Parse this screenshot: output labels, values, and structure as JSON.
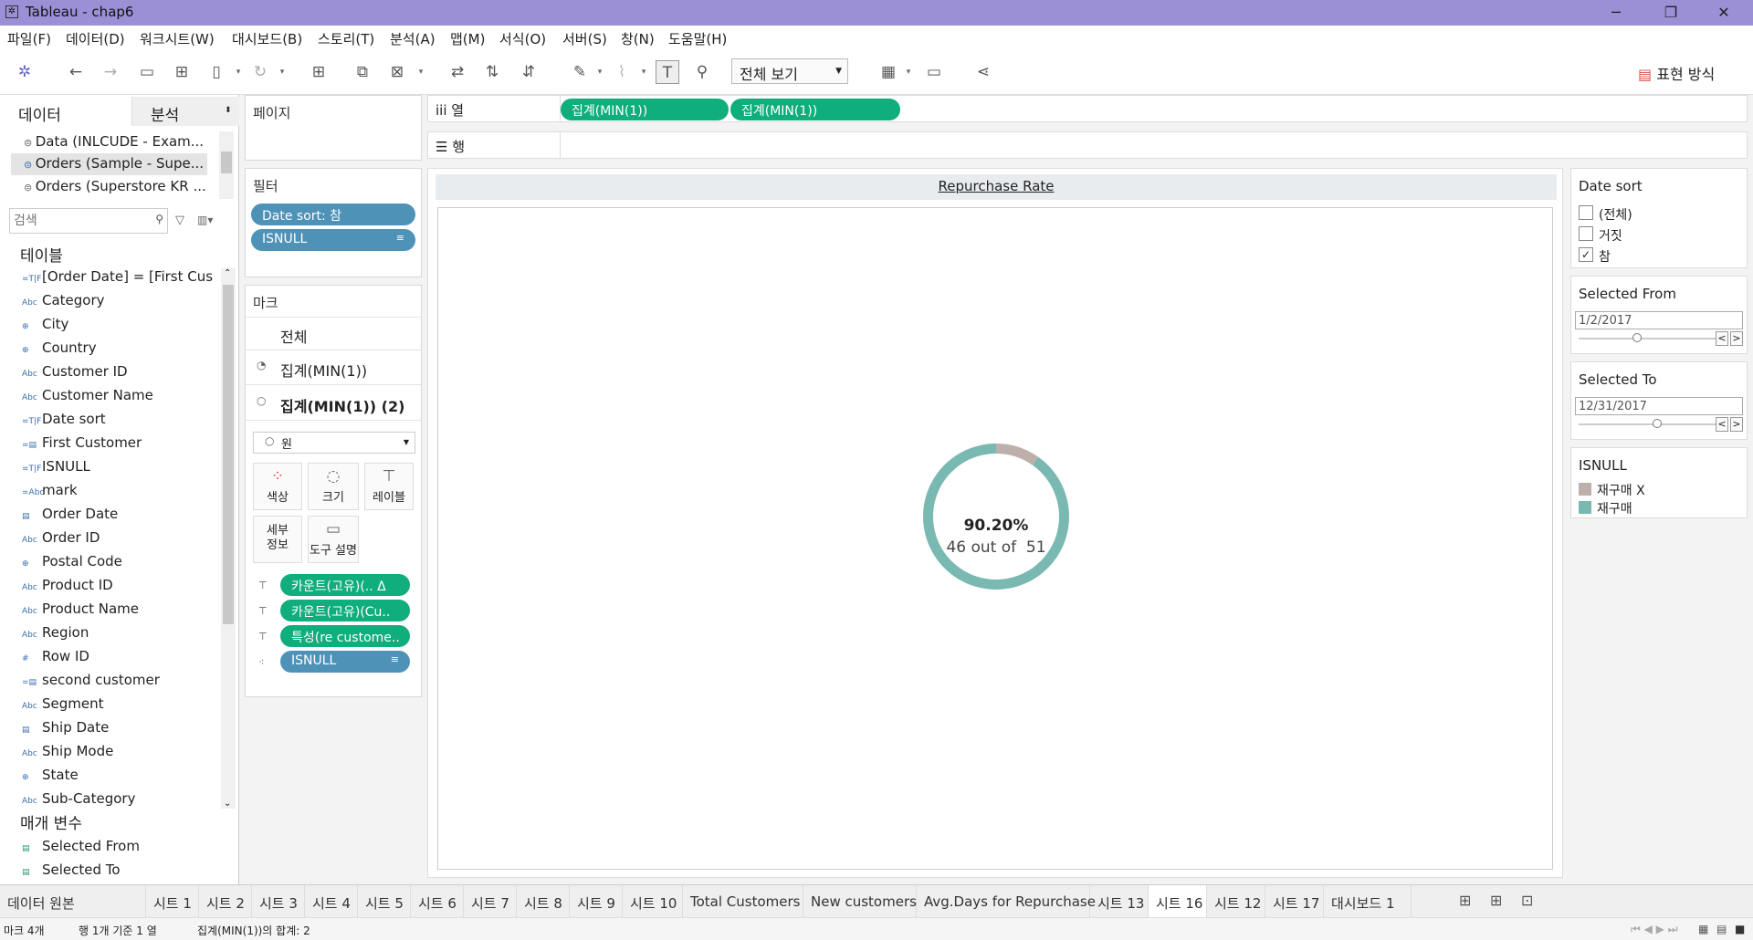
{
  "window": {
    "title": "Tableau - chap6"
  },
  "menu": [
    "파일(F)",
    "데이터(D)",
    "워크시트(W)",
    "대시보드(B)",
    "스토리(T)",
    "분석(A)",
    "맵(M)",
    "서식(O)",
    "서버(S)",
    "창(N)",
    "도움말(H)"
  ],
  "toolbar": {
    "view_select": "전체 보기",
    "show_me": "표현 방식"
  },
  "data_pane": {
    "tabs": [
      "데이터",
      "분석"
    ],
    "sources": [
      "Data (INLCUDE - Exam...",
      "Orders (Sample - Supe...",
      "Orders (Superstore KR ..."
    ],
    "search_placeholder": "검색",
    "tables_header": "테이블",
    "fields": [
      {
        "icon": "=T|F",
        "name": "[Order Date] = [First Cus..."
      },
      {
        "icon": "Abc",
        "name": "Category"
      },
      {
        "icon": "⊕",
        "name": "City"
      },
      {
        "icon": "⊕",
        "name": "Country"
      },
      {
        "icon": "Abc",
        "name": "Customer ID"
      },
      {
        "icon": "Abc",
        "name": "Customer Name"
      },
      {
        "icon": "=T|F",
        "name": "Date sort"
      },
      {
        "icon": "=▤",
        "name": "First Customer"
      },
      {
        "icon": "=T|F",
        "name": "ISNULL"
      },
      {
        "icon": "=Abc",
        "name": "mark"
      },
      {
        "icon": "▤",
        "name": "Order Date"
      },
      {
        "icon": "Abc",
        "name": "Order ID"
      },
      {
        "icon": "⊕",
        "name": "Postal Code"
      },
      {
        "icon": "Abc",
        "name": "Product ID"
      },
      {
        "icon": "Abc",
        "name": "Product Name"
      },
      {
        "icon": "Abc",
        "name": "Region"
      },
      {
        "icon": "#",
        "name": "Row ID"
      },
      {
        "icon": "=▤",
        "name": "second customer"
      },
      {
        "icon": "Abc",
        "name": "Segment"
      },
      {
        "icon": "▤",
        "name": "Ship Date"
      },
      {
        "icon": "Abc",
        "name": "Ship Mode"
      },
      {
        "icon": "⊕",
        "name": "State"
      },
      {
        "icon": "Abc",
        "name": "Sub-Category"
      }
    ],
    "params_header": "매개 변수",
    "params": [
      "Selected From",
      "Selected To"
    ]
  },
  "pages": {
    "title": "페이지"
  },
  "filters": {
    "title": "필터",
    "pills": [
      "Date sort: 참",
      "ISNULL"
    ]
  },
  "marks": {
    "title": "마크",
    "rows": [
      "전체",
      "집계(MIN(1))",
      "집계(MIN(1)) (2)"
    ],
    "type": "원",
    "buttons": [
      "색상",
      "크기",
      "레이블",
      "세부\n정보",
      "도구 설명"
    ],
    "pills": [
      "카운트(고유)(..  Δ",
      "카운트(고유)(Cu..",
      "특성(re custome..",
      "ISNULL"
    ]
  },
  "shelves": {
    "columns_label": "열",
    "rows_label": "행",
    "columns_pills": [
      "집계(MIN(1))",
      "집계(MIN(1))"
    ]
  },
  "view": {
    "title": "Repurchase Rate",
    "pct": "90.20%",
    "sub": "46 out of  51"
  },
  "chart_data": {
    "type": "pie",
    "categories": [
      "재구매",
      "재구매 X"
    ],
    "values": [
      46,
      5
    ],
    "colors": [
      "#79b9b2",
      "#bdafa9"
    ]
  },
  "right": {
    "date_sort": {
      "title": "Date sort",
      "options": [
        {
          "label": "(전체)",
          "checked": false
        },
        {
          "label": "거짓",
          "checked": false
        },
        {
          "label": "참",
          "checked": true
        }
      ]
    },
    "selected_from": {
      "title": "Selected From",
      "value": "1/2/2017",
      "level": 0.42
    },
    "selected_to": {
      "title": "Selected To",
      "value": "12/31/2017",
      "level": 0.58
    },
    "legend": {
      "title": "ISNULL",
      "items": [
        {
          "label": "재구매 X",
          "color": "#bdafa9"
        },
        {
          "label": "재구매",
          "color": "#79b9b2"
        }
      ]
    }
  },
  "tabs": [
    "데이터 원본",
    "시트 1",
    "시트 2",
    "시트 3",
    "시트 4",
    "시트 5",
    "시트 6",
    "시트 7",
    "시트 8",
    "시트 9",
    "시트 10",
    "Total Customers",
    "New customers",
    "Avg.Days for Repurchase",
    "시트 13",
    "시트 16",
    "시트 12",
    "시트 17",
    "대시보드 1"
  ],
  "active_tab": "시트 16",
  "status": {
    "marks": "마크 4개",
    "rows": "행 1개 기준 1 열",
    "sum": "집계(MIN(1))의 합계: 2"
  }
}
